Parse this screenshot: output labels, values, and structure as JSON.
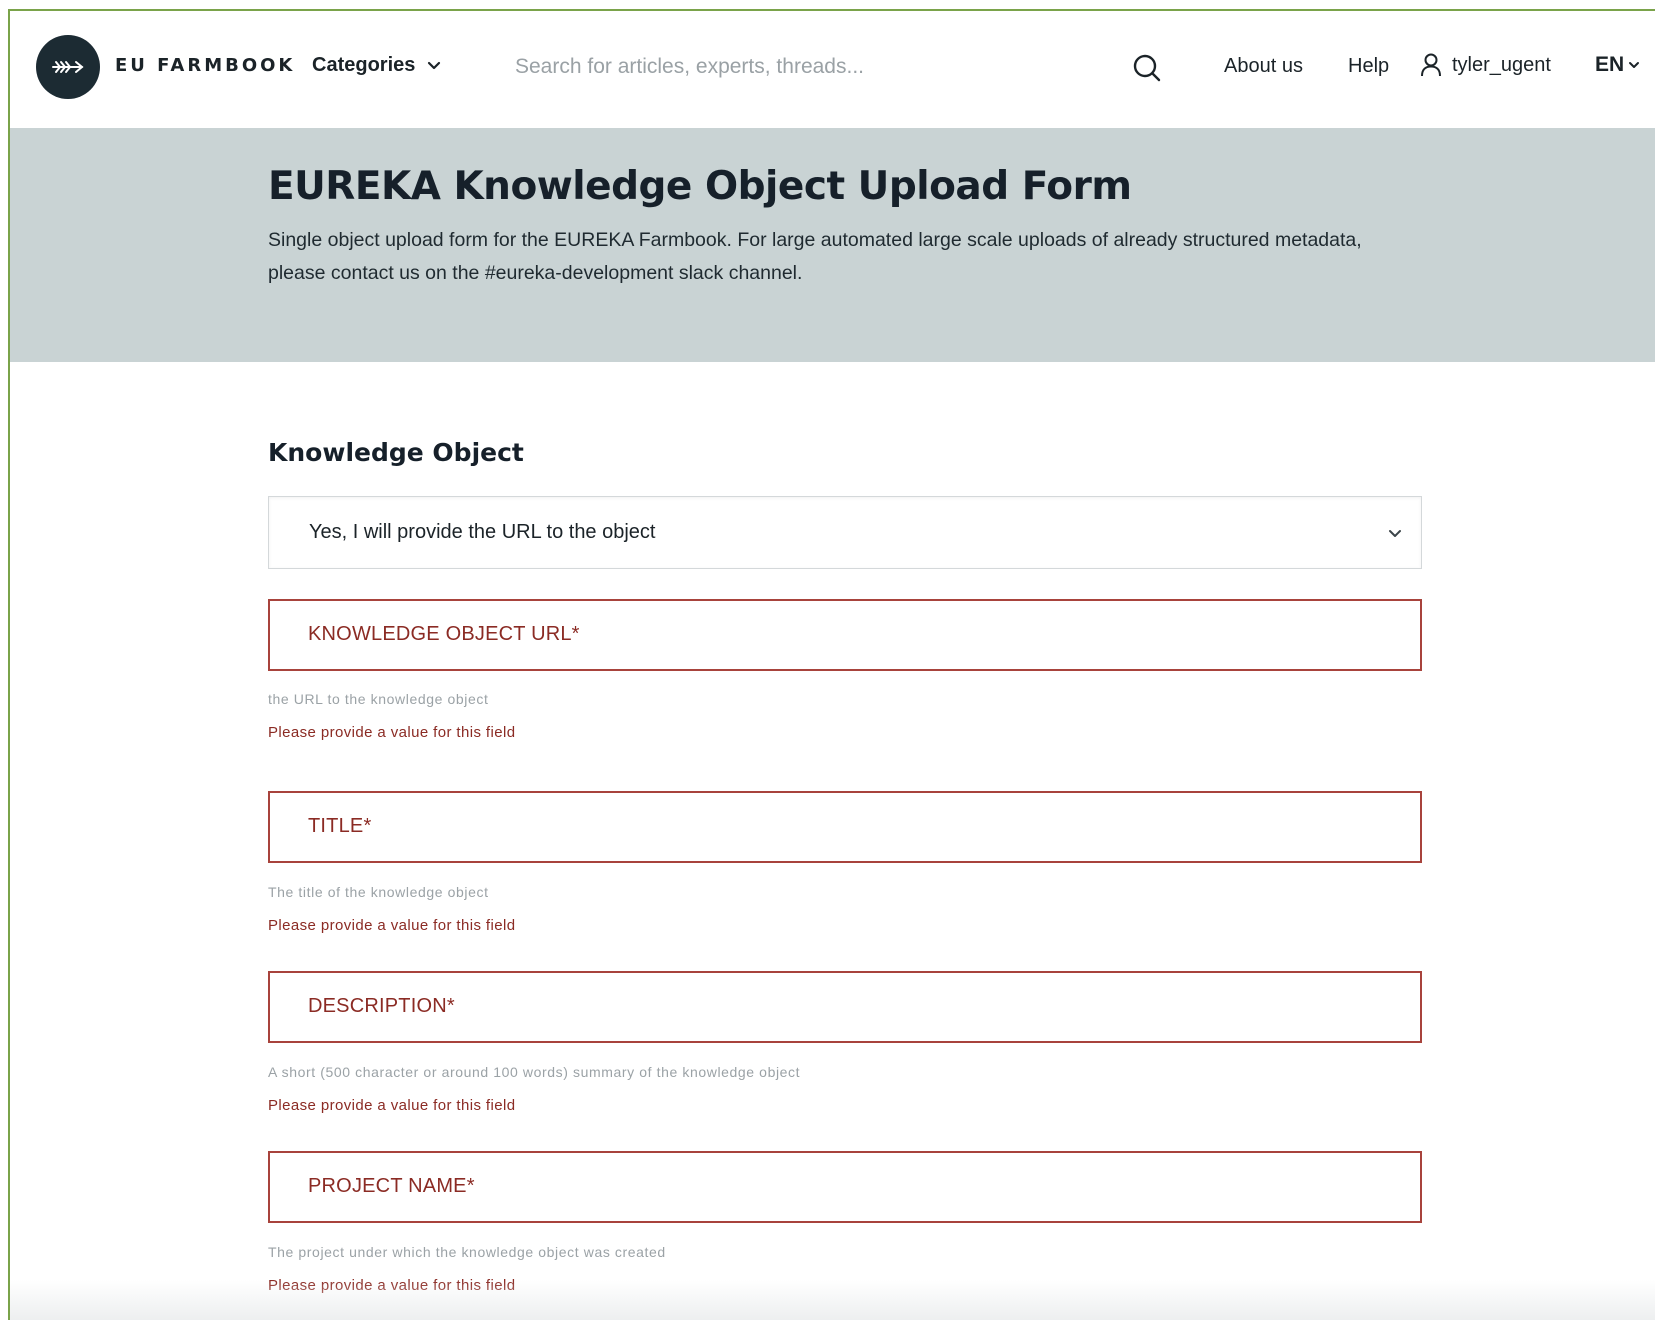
{
  "header": {
    "brand": "EU FARMBOOK",
    "logo_icon": "arrow-icon",
    "categories_label": "Categories",
    "search": {
      "placeholder": "Search for articles, experts, threads...",
      "value": ""
    },
    "nav": {
      "about": "About us",
      "help": "Help"
    },
    "user": {
      "username": "tyler_ugent"
    },
    "language": "EN"
  },
  "hero": {
    "title": "EUREKA Knowledge Object Upload Form",
    "description_line1": "Single object upload form for the EUREKA Farmbook. For large automated large scale uploads of already structured metadata,",
    "description_line2": "please contact us on the #eureka-development slack channel."
  },
  "form": {
    "section_title": "Knowledge Object",
    "url_choice": {
      "selected": "Yes, I will provide the URL to the object"
    },
    "fields": [
      {
        "label": "KNOWLEDGE OBJECT URL*",
        "hint": "the URL to the knowledge object",
        "error": "Please provide a value for this field"
      },
      {
        "label": "TITLE*",
        "hint": "The title of the knowledge object",
        "error": "Please provide a value for this field"
      },
      {
        "label": "DESCRIPTION*",
        "hint": "A short (500 character or around 100 words) summary of the knowledge object",
        "error": "Please provide a value for this field"
      },
      {
        "label": "PROJECT NAME*",
        "hint": "The project under which the knowledge object was created",
        "error": "Please provide a value for this field"
      }
    ]
  },
  "colors": {
    "hero_background": "#c9d3d4",
    "error_red": "#8b2b24",
    "field_border_error": "#a8433c",
    "logo_background": "#1c2b33",
    "frame_green": "#7aa34a"
  }
}
